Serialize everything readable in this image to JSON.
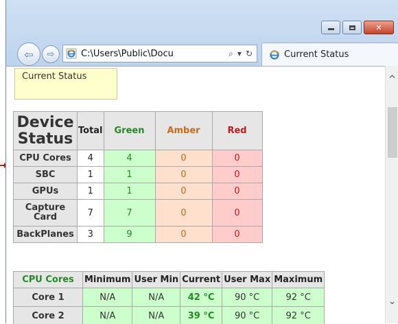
{
  "window": {
    "minimize_label": "",
    "maximize_label": "",
    "close_label": "✕"
  },
  "navbar": {
    "back_glyph": "⇦",
    "forward_glyph": "⇨",
    "address": "C:\\Users\\Public\\Docu",
    "search_glyph": "⌕",
    "dropdown_glyph": "▾",
    "refresh_glyph": "↻",
    "tab_title": "Current Status"
  },
  "status_box": {
    "label": "Current Status"
  },
  "device_table": {
    "header_device": "Device Status",
    "header_total": "Total",
    "header_green": "Green",
    "header_amber": "Amber",
    "header_red": "Red",
    "rows": [
      {
        "label": "CPU Cores",
        "total": "4",
        "green": "4",
        "amber": "0",
        "red": "0"
      },
      {
        "label": "SBC",
        "total": "1",
        "green": "1",
        "amber": "0",
        "red": "0"
      },
      {
        "label": "GPUs",
        "total": "1",
        "green": "1",
        "amber": "0",
        "red": "0"
      },
      {
        "label": "Capture Card",
        "total": "7",
        "green": "7",
        "amber": "0",
        "red": "0"
      },
      {
        "label": "BackPlanes",
        "total": "3",
        "green": "9",
        "amber": "0",
        "red": "0"
      }
    ]
  },
  "cpu_table": {
    "header_cpu": "CPU Cores",
    "header_min": "Minimum",
    "header_user_min": "User Min",
    "header_current": "Current",
    "header_user_max": "User Max",
    "header_max": "Maximum",
    "rows": [
      {
        "label": "Core 1",
        "min": "N/A",
        "user_min": "N/A",
        "current": "42 °C",
        "user_max": "90 °C",
        "max": "92 °C"
      },
      {
        "label": "Core 2",
        "min": "N/A",
        "user_min": "N/A",
        "current": "39 °C",
        "user_max": "90 °C",
        "max": "92 °C"
      }
    ]
  },
  "scrollbar": {
    "up_glyph": "^",
    "down_glyph": "⌄",
    "position_fraction": 0.15
  },
  "colors": {
    "green_text": "#238a23",
    "amber_text": "#c46c18",
    "red_text": "#c21b1b",
    "green_bg": "#ccffcc",
    "amber_bg": "#ffe0cc",
    "red_bg": "#ffcccc",
    "status_box_bg": "#ffffcc"
  }
}
